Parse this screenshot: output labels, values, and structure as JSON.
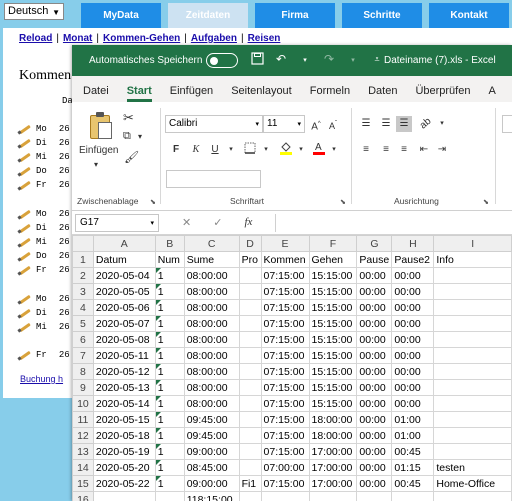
{
  "web": {
    "language": "Deutsch",
    "nav_tabs": [
      "MyData",
      "Zeitdaten",
      "Firma",
      "Schritte",
      "Kontakt"
    ],
    "active_tab": 1,
    "sublinks": [
      "Reload",
      "Monat",
      "Kommen-Gehen",
      "Aufgaben",
      "Reisen"
    ],
    "title": "Kommen",
    "col_header": "Da",
    "rows": [
      {
        "day": "Mo",
        "date": "26"
      },
      {
        "day": "Di",
        "date": "26"
      },
      {
        "day": "Mi",
        "date": "26"
      },
      {
        "day": "Do",
        "date": "26"
      },
      {
        "day": "Fr",
        "date": "26"
      },
      {
        "day": "Mo",
        "date": "26"
      },
      {
        "day": "Di",
        "date": "26"
      },
      {
        "day": "Mi",
        "date": "26"
      },
      {
        "day": "Do",
        "date": "26"
      },
      {
        "day": "Fr",
        "date": "26"
      },
      {
        "day": "Mo",
        "date": "26"
      },
      {
        "day": "Di",
        "date": "26"
      },
      {
        "day": "Mi",
        "date": "26"
      },
      {
        "day": "Fr",
        "date": "26"
      }
    ],
    "bottom_link": "Buchung h"
  },
  "excel": {
    "autosave_label": "Automatisches Speichern",
    "filename": "Dateiname (7).xls  -  Excel",
    "menu": [
      "Datei",
      "Start",
      "Einfügen",
      "Seitenlayout",
      "Formeln",
      "Daten",
      "Überprüfen",
      "A"
    ],
    "active_menu": 1,
    "ribbon": {
      "paste_label": "Einfügen",
      "clipboard_label": "Zwischenablage",
      "font_label": "Schriftart",
      "align_label": "Ausrichtung",
      "font_name": "Calibri",
      "font_size": "11",
      "bold": "F",
      "italic": "K",
      "underline": "U",
      "highlight_color": "#ffff00",
      "font_color": "#ff0000"
    },
    "name_box": "G17",
    "fx": "fx",
    "columns": [
      "A",
      "B",
      "C",
      "D",
      "E",
      "F",
      "G",
      "H",
      "I"
    ],
    "rows": [
      {
        "n": "1",
        "cells": [
          "Datum",
          "Num",
          "Sume",
          "Pro",
          "Kommen",
          "Gehen",
          "Pause",
          "Pause2",
          "Info"
        ]
      },
      {
        "n": "2",
        "cells": [
          "2020-05-04",
          "1",
          "08:00:00",
          "",
          "07:15:00",
          "15:15:00",
          "00:00",
          "00:00",
          ""
        ]
      },
      {
        "n": "3",
        "cells": [
          "2020-05-05",
          "1",
          "08:00:00",
          "",
          "07:15:00",
          "15:15:00",
          "00:00",
          "00:00",
          ""
        ]
      },
      {
        "n": "4",
        "cells": [
          "2020-05-06",
          "1",
          "08:00:00",
          "",
          "07:15:00",
          "15:15:00",
          "00:00",
          "00:00",
          ""
        ]
      },
      {
        "n": "5",
        "cells": [
          "2020-05-07",
          "1",
          "08:00:00",
          "",
          "07:15:00",
          "15:15:00",
          "00:00",
          "00:00",
          ""
        ]
      },
      {
        "n": "6",
        "cells": [
          "2020-05-08",
          "1",
          "08:00:00",
          "",
          "07:15:00",
          "15:15:00",
          "00:00",
          "00:00",
          ""
        ]
      },
      {
        "n": "7",
        "cells": [
          "2020-05-11",
          "1",
          "08:00:00",
          "",
          "07:15:00",
          "15:15:00",
          "00:00",
          "00:00",
          ""
        ]
      },
      {
        "n": "8",
        "cells": [
          "2020-05-12",
          "1",
          "08:00:00",
          "",
          "07:15:00",
          "15:15:00",
          "00:00",
          "00:00",
          ""
        ]
      },
      {
        "n": "9",
        "cells": [
          "2020-05-13",
          "1",
          "08:00:00",
          "",
          "07:15:00",
          "15:15:00",
          "00:00",
          "00:00",
          ""
        ]
      },
      {
        "n": "10",
        "cells": [
          "2020-05-14",
          "1",
          "08:00:00",
          "",
          "07:15:00",
          "15:15:00",
          "00:00",
          "00:00",
          ""
        ]
      },
      {
        "n": "11",
        "cells": [
          "2020-05-15",
          "1",
          "09:45:00",
          "",
          "07:15:00",
          "18:00:00",
          "00:00",
          "01:00",
          ""
        ]
      },
      {
        "n": "12",
        "cells": [
          "2020-05-18",
          "1",
          "09:45:00",
          "",
          "07:15:00",
          "18:00:00",
          "00:00",
          "01:00",
          ""
        ]
      },
      {
        "n": "13",
        "cells": [
          "2020-05-19",
          "1",
          "09:00:00",
          "",
          "07:15:00",
          "17:00:00",
          "00:00",
          "00:45",
          ""
        ]
      },
      {
        "n": "14",
        "cells": [
          "2020-05-20",
          "1",
          "08:45:00",
          "",
          "07:00:00",
          "17:00:00",
          "00:00",
          "01:15",
          "testen"
        ]
      },
      {
        "n": "15",
        "cells": [
          "2020-05-22",
          "1",
          "09:00:00",
          "Fi1",
          "07:15:00",
          "17:00:00",
          "00:00",
          "00:45",
          "Home-Office"
        ]
      },
      {
        "n": "16",
        "cells": [
          "",
          "",
          "118:15:00",
          "",
          "",
          "",
          "",
          "",
          ""
        ]
      },
      {
        "n": "17",
        "cells": [
          "",
          "",
          "",
          "",
          "",
          "",
          "",
          "",
          ""
        ]
      }
    ]
  }
}
